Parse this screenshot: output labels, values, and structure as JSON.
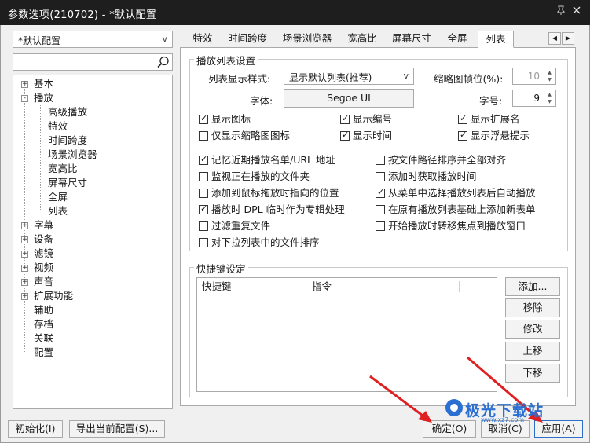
{
  "window": {
    "title": "参数选项(210702) - *默认配置",
    "pin_icon": "pin-icon",
    "close_icon": "close-icon"
  },
  "profile_combo": {
    "value": "*默认配置"
  },
  "search": {
    "value": "",
    "icon": "search-icon"
  },
  "tree": {
    "items": [
      {
        "label": "基本",
        "level": 0,
        "expander": "+"
      },
      {
        "label": "播放",
        "level": 0,
        "expander": "-"
      },
      {
        "label": "高级播放",
        "level": 1
      },
      {
        "label": "特效",
        "level": 1
      },
      {
        "label": "时间跨度",
        "level": 1
      },
      {
        "label": "场景浏览器",
        "level": 1
      },
      {
        "label": "宽高比",
        "level": 1
      },
      {
        "label": "屏幕尺寸",
        "level": 1
      },
      {
        "label": "全屏",
        "level": 1
      },
      {
        "label": "列表",
        "level": 1
      },
      {
        "label": "字幕",
        "level": 0,
        "expander": "+"
      },
      {
        "label": "设备",
        "level": 0,
        "expander": "+"
      },
      {
        "label": "滤镜",
        "level": 0,
        "expander": "+"
      },
      {
        "label": "视频",
        "level": 0,
        "expander": "+"
      },
      {
        "label": "声音",
        "level": 0,
        "expander": "+"
      },
      {
        "label": "扩展功能",
        "level": 0,
        "expander": "+"
      },
      {
        "label": "辅助",
        "level": 0
      },
      {
        "label": "存档",
        "level": 0
      },
      {
        "label": "关联",
        "level": 0
      },
      {
        "label": "配置",
        "level": 0
      }
    ]
  },
  "tabs": [
    {
      "label": "特效"
    },
    {
      "label": "时间跨度"
    },
    {
      "label": "场景浏览器"
    },
    {
      "label": "宽高比"
    },
    {
      "label": "屏幕尺寸"
    },
    {
      "label": "全屏"
    },
    {
      "label": "列表",
      "active": true
    }
  ],
  "tab_scroll": {
    "left": "◀",
    "right": "▶"
  },
  "playlist_settings": {
    "group_title": "播放列表设置",
    "display_style_label": "列表显示样式:",
    "display_style_value": "显示默认列表(推荐)",
    "thumb_frame_label": "缩略图帧位(%):",
    "thumb_frame_value": "10",
    "font_label": "字体:",
    "font_button": "Segoe UI",
    "size_label": "字号:",
    "size_value": "9"
  },
  "checkboxes_top": [
    {
      "label": "显示图标",
      "checked": true
    },
    {
      "label": "显示编号",
      "checked": true
    },
    {
      "label": "显示扩展名",
      "checked": true
    },
    {
      "label": "仅显示缩略图图标",
      "checked": false
    },
    {
      "label": "显示时间",
      "checked": true
    },
    {
      "label": "显示浮悬提示",
      "checked": true
    }
  ],
  "checkboxes_options": [
    {
      "label": "记忆近期播放名单/URL 地址",
      "checked": true
    },
    {
      "label": "按文件路径排序并全部对齐",
      "checked": false
    },
    {
      "label": "监视正在播放的文件夹",
      "checked": false
    },
    {
      "label": "添加时获取播放时间",
      "checked": false
    },
    {
      "label": "添加到鼠标拖放时指向的位置",
      "checked": false
    },
    {
      "label": "从菜单中选择播放列表后自动播放",
      "checked": true
    },
    {
      "label": "播放时 DPL 临时作为专辑处理",
      "checked": true
    },
    {
      "label": "在原有播放列表基础上添加新表单",
      "checked": false
    },
    {
      "label": "过滤重复文件",
      "checked": false
    },
    {
      "label": "开始播放时转移焦点到播放窗口",
      "checked": false
    },
    {
      "label": "对下拉列表中的文件排序",
      "checked": false
    }
  ],
  "shortcuts": {
    "group_title": "快捷键设定",
    "col_shortcut": "快捷键",
    "col_command": "指令",
    "add_button": "添加...",
    "remove_button": "移除",
    "edit_button": "修改",
    "up_button": "上移",
    "down_button": "下移"
  },
  "footer": {
    "init_button": "初始化(I)",
    "export_button": "导出当前配置(S)...",
    "ok_button": "确定(O)",
    "cancel_button": "取消(C)",
    "apply_button": "应用(A)"
  },
  "watermark": {
    "text": "极光下载站",
    "url": "www.xz7.com"
  },
  "colors": {
    "titlebar": "#1e1e1e",
    "annotation_arrow": "#e02020",
    "watermark": "#2a6fd1"
  }
}
